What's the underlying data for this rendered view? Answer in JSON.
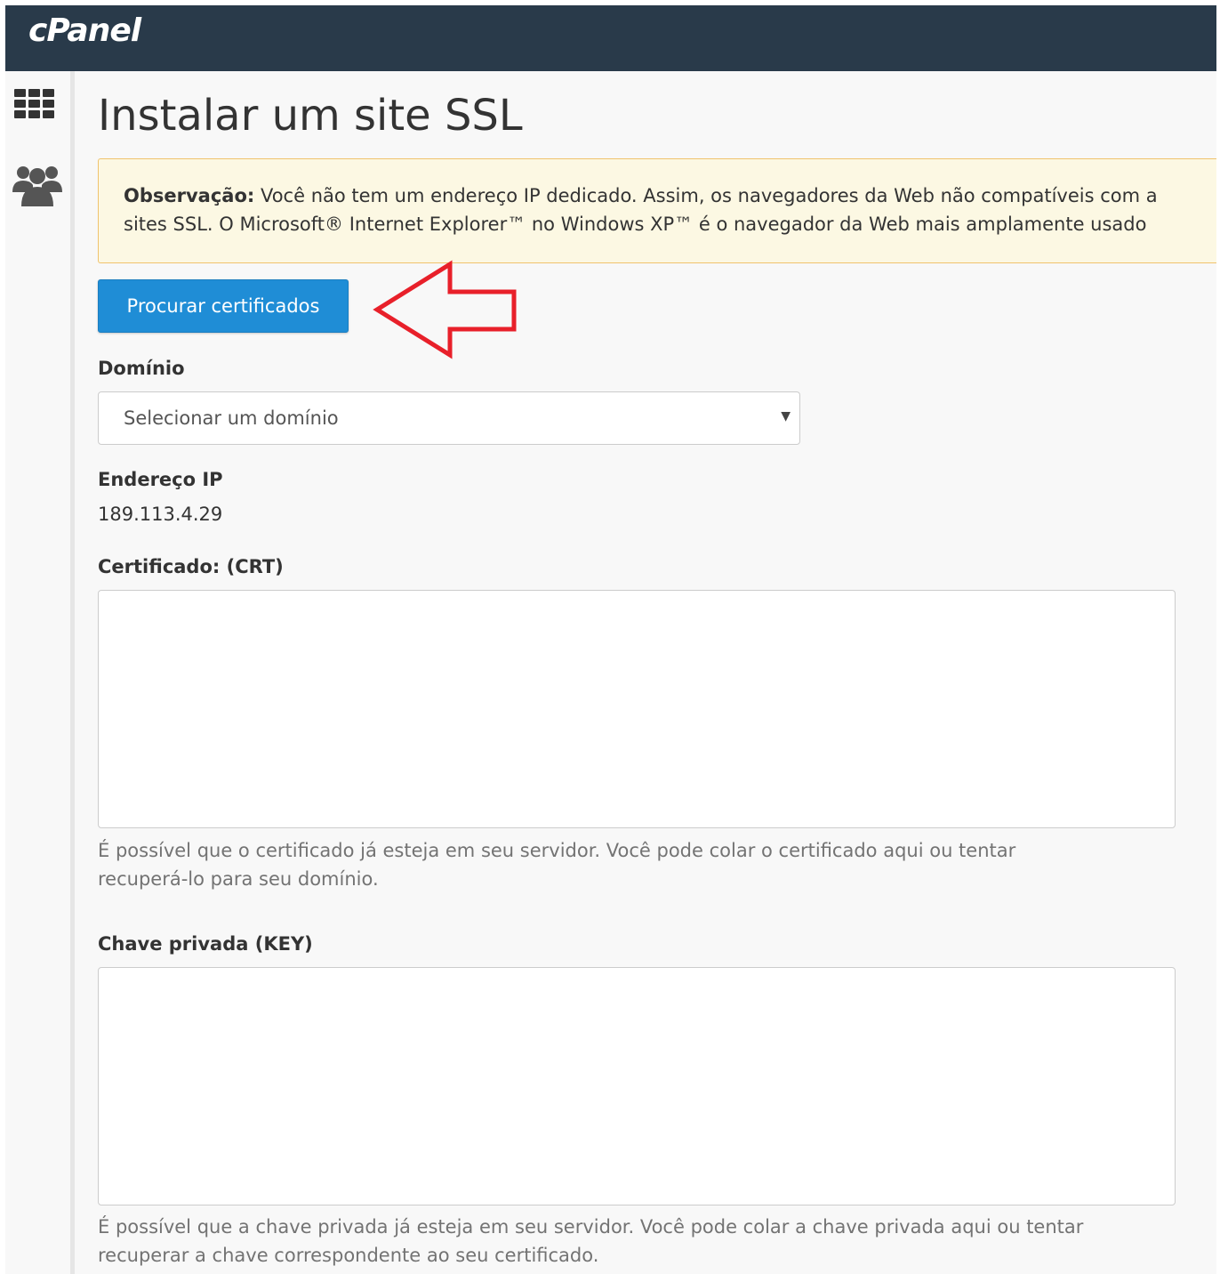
{
  "header": {
    "logo_text": "cPanel",
    "background": "#293a4a"
  },
  "sidebar": {
    "items": [
      {
        "icon": "grid-icon"
      },
      {
        "icon": "users-icon"
      }
    ]
  },
  "page": {
    "title": "Instalar um site SSL"
  },
  "alert": {
    "label": "Observação:",
    "line1": " Você não tem um endereço IP dedicado. Assim, os navegadores da Web não compatíveis com a",
    "line2": "sites SSL. O Microsoft® Internet Explorer™ no Windows XP™ é o navegador da Web mais amplamente usado"
  },
  "browse_button": {
    "label": "Procurar certificados",
    "color": "#1f8dd6"
  },
  "annotation": {
    "arrow_color": "#e8202a"
  },
  "domain": {
    "label": "Domínio",
    "selected": "Selecionar um domínio"
  },
  "ip": {
    "label": "Endereço IP",
    "value": "189.113.4.29"
  },
  "certificate": {
    "label": "Certificado: (CRT)",
    "value": "",
    "help_line1": "É possível que o certificado já esteja em seu servidor. Você pode colar o certificado aqui ou tentar",
    "help_line2": "recuperá-lo para seu domínio."
  },
  "private_key": {
    "label": "Chave privada (KEY)",
    "value": "",
    "help_line1": "É possível que a chave privada já esteja em seu servidor. Você pode colar a chave privada aqui ou tentar",
    "help_line2": "recuperar a chave correspondente ao seu certificado."
  }
}
